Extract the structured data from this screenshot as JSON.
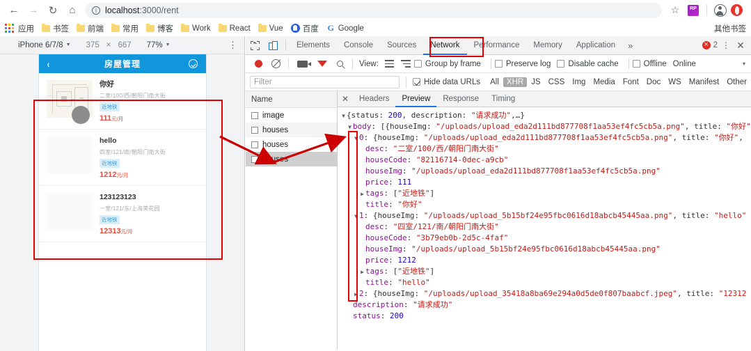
{
  "browser": {
    "url_text": "localhost",
    "url_dim": ":3000/rent",
    "nav": {
      "back": "←",
      "forward": "→",
      "reload": "↻",
      "home": "⌂"
    },
    "star": "☆",
    "bookmarks": [
      {
        "label": "书签",
        "icon": "folder-icon"
      },
      {
        "label": "前端",
        "icon": "folder-icon"
      },
      {
        "label": "常用",
        "icon": "folder-icon"
      },
      {
        "label": "博客",
        "icon": "folder-icon"
      },
      {
        "label": "Work",
        "icon": "folder-icon"
      },
      {
        "label": "React",
        "icon": "folder-icon"
      },
      {
        "label": "Vue",
        "icon": "folder-icon"
      }
    ],
    "apps_label": "应用",
    "baidu_label": "百度",
    "google_label": "Google",
    "other_bookmarks": "其他书签"
  },
  "device_toolbar": {
    "device": "iPhone 6/7/8",
    "width": "375",
    "times": "×",
    "height": "667",
    "zoom": "77%",
    "caret": "▼"
  },
  "app": {
    "header_title": "房屋管理",
    "back_icon": "‹",
    "houses": [
      {
        "title": "你好",
        "desc": "二室/100/西/朝阳门南大街",
        "tag": "近地铁",
        "price": "111",
        "unit": "元/月"
      },
      {
        "title": "hello",
        "desc": "四室/121/南/朝阳门南大街",
        "tag": "近地铁",
        "price": "1212",
        "unit": "元/月"
      },
      {
        "title": "123123123",
        "desc": "一室/121/东/上海荣花园",
        "tag": "近地铁",
        "price": "12313",
        "unit": "元/月"
      }
    ]
  },
  "devtools": {
    "tabs": [
      {
        "label": "Elements",
        "active": false
      },
      {
        "label": "Console",
        "active": false
      },
      {
        "label": "Sources",
        "active": false
      },
      {
        "label": "Network",
        "active": true
      },
      {
        "label": "Performance",
        "active": false
      },
      {
        "label": "Memory",
        "active": false
      },
      {
        "label": "Application",
        "active": false
      }
    ],
    "more_tabs": "»",
    "error_count": "2",
    "close": "✕",
    "controls": {
      "view_label": "View:",
      "group_by_frame": "Group by frame",
      "preserve_log": "Preserve log",
      "disable_cache": "Disable cache",
      "offline": "Offline",
      "online": "Online",
      "caret": "▾"
    },
    "filter": {
      "placeholder": "Filter",
      "value": "",
      "hide_data_urls": "Hide data URLs",
      "types": [
        {
          "label": "All",
          "active": false
        },
        {
          "label": "XHR",
          "active": true
        },
        {
          "label": "JS",
          "active": false
        },
        {
          "label": "CSS",
          "active": false
        },
        {
          "label": "Img",
          "active": false
        },
        {
          "label": "Media",
          "active": false
        },
        {
          "label": "Font",
          "active": false
        },
        {
          "label": "Doc",
          "active": false
        },
        {
          "label": "WS",
          "active": false
        },
        {
          "label": "Manifest",
          "active": false
        },
        {
          "label": "Other",
          "active": false
        }
      ]
    },
    "network": {
      "column_header": "Name",
      "rows": [
        {
          "name": "image",
          "selected": false
        },
        {
          "name": "houses",
          "selected": false
        },
        {
          "name": "houses",
          "selected": false
        },
        {
          "name": "houses",
          "selected": true
        }
      ]
    },
    "detail_tabs": [
      {
        "label": "Headers",
        "active": false
      },
      {
        "label": "Preview",
        "active": true
      },
      {
        "label": "Response",
        "active": false
      },
      {
        "label": "Timing",
        "active": false
      }
    ],
    "preview_json": [
      {
        "indent": 0,
        "tri": "down",
        "parts": [
          {
            "t": "{status: ",
            "c": "p"
          },
          {
            "t": "200",
            "c": "n"
          },
          {
            "t": ", description: ",
            "c": "p"
          },
          {
            "t": "\"请求成功\"",
            "c": "s"
          },
          {
            "t": ",…}",
            "c": "p"
          }
        ]
      },
      {
        "indent": 1,
        "tri": "down",
        "parts": [
          {
            "t": "body",
            "c": "k"
          },
          {
            "t": ": [{houseImg: ",
            "c": "p"
          },
          {
            "t": "\"/uploads/upload_eda2d111bd877708f1aa53ef4fc5cb5a.png\"",
            "c": "s"
          },
          {
            "t": ", title: ",
            "c": "p"
          },
          {
            "t": "\"你好\"",
            "c": "s"
          }
        ]
      },
      {
        "indent": 2,
        "tri": "down",
        "parts": [
          {
            "t": "0",
            "c": "ki"
          },
          {
            "t": ": {houseImg: ",
            "c": "p"
          },
          {
            "t": "\"/uploads/upload_eda2d111bd877708f1aa53ef4fc5cb5a.png\"",
            "c": "s"
          },
          {
            "t": ", title: ",
            "c": "p"
          },
          {
            "t": "\"你好\"",
            "c": "s"
          },
          {
            "t": ",",
            "c": "p"
          }
        ]
      },
      {
        "indent": 3,
        "tri": "blank",
        "parts": [
          {
            "t": "desc",
            "c": "k"
          },
          {
            "t": ": ",
            "c": "p"
          },
          {
            "t": "\"二室/100/西/朝阳门南大街\"",
            "c": "s"
          }
        ]
      },
      {
        "indent": 3,
        "tri": "blank",
        "parts": [
          {
            "t": "houseCode",
            "c": "k"
          },
          {
            "t": ": ",
            "c": "p"
          },
          {
            "t": "\"82116714-0dec-a9cb\"",
            "c": "s"
          }
        ]
      },
      {
        "indent": 3,
        "tri": "blank",
        "parts": [
          {
            "t": "houseImg",
            "c": "k"
          },
          {
            "t": ": ",
            "c": "p"
          },
          {
            "t": "\"/uploads/upload_eda2d111bd877708f1aa53ef4fc5cb5a.png\"",
            "c": "s"
          }
        ]
      },
      {
        "indent": 3,
        "tri": "blank",
        "parts": [
          {
            "t": "price",
            "c": "k"
          },
          {
            "t": ": ",
            "c": "p"
          },
          {
            "t": "111",
            "c": "n"
          }
        ]
      },
      {
        "indent": 3,
        "tri": "right",
        "parts": [
          {
            "t": "tags",
            "c": "k"
          },
          {
            "t": ": [",
            "c": "p"
          },
          {
            "t": "\"近地铁\"",
            "c": "s"
          },
          {
            "t": "]",
            "c": "p"
          }
        ]
      },
      {
        "indent": 3,
        "tri": "blank",
        "parts": [
          {
            "t": "title",
            "c": "k"
          },
          {
            "t": ": ",
            "c": "p"
          },
          {
            "t": "\"你好\"",
            "c": "s"
          }
        ]
      },
      {
        "indent": 2,
        "tri": "down",
        "parts": [
          {
            "t": "1",
            "c": "ki"
          },
          {
            "t": ": {houseImg: ",
            "c": "p"
          },
          {
            "t": "\"/uploads/upload_5b15bf24e95fbc0616d18abcb45445aa.png\"",
            "c": "s"
          },
          {
            "t": ", title: ",
            "c": "p"
          },
          {
            "t": "\"hello\"",
            "c": "s"
          }
        ]
      },
      {
        "indent": 3,
        "tri": "blank",
        "parts": [
          {
            "t": "desc",
            "c": "k"
          },
          {
            "t": ": ",
            "c": "p"
          },
          {
            "t": "\"四室/121/南/朝阳门南大街\"",
            "c": "s"
          }
        ]
      },
      {
        "indent": 3,
        "tri": "blank",
        "parts": [
          {
            "t": "houseCode",
            "c": "k"
          },
          {
            "t": ": ",
            "c": "p"
          },
          {
            "t": "\"3b79eb0b-2d5c-4faf\"",
            "c": "s"
          }
        ]
      },
      {
        "indent": 3,
        "tri": "blank",
        "parts": [
          {
            "t": "houseImg",
            "c": "k"
          },
          {
            "t": ": ",
            "c": "p"
          },
          {
            "t": "\"/uploads/upload_5b15bf24e95fbc0616d18abcb45445aa.png\"",
            "c": "s"
          }
        ]
      },
      {
        "indent": 3,
        "tri": "blank",
        "parts": [
          {
            "t": "price",
            "c": "k"
          },
          {
            "t": ": ",
            "c": "p"
          },
          {
            "t": "1212",
            "c": "n"
          }
        ]
      },
      {
        "indent": 3,
        "tri": "right",
        "parts": [
          {
            "t": "tags",
            "c": "k"
          },
          {
            "t": ": [",
            "c": "p"
          },
          {
            "t": "\"近地铁\"",
            "c": "s"
          },
          {
            "t": "]",
            "c": "p"
          }
        ]
      },
      {
        "indent": 3,
        "tri": "blank",
        "parts": [
          {
            "t": "title",
            "c": "k"
          },
          {
            "t": ": ",
            "c": "p"
          },
          {
            "t": "\"hello\"",
            "c": "s"
          }
        ]
      },
      {
        "indent": 2,
        "tri": "right",
        "parts": [
          {
            "t": "2",
            "c": "ki"
          },
          {
            "t": ": {houseImg: ",
            "c": "p"
          },
          {
            "t": "\"/uploads/upload_35418a8ba69e294a0d5de0f807baabcf.jpeg\"",
            "c": "s"
          },
          {
            "t": ", title: ",
            "c": "p"
          },
          {
            "t": "\"12312",
            "c": "s"
          }
        ]
      },
      {
        "indent": 1,
        "tri": "blank",
        "parts": [
          {
            "t": "description",
            "c": "k"
          },
          {
            "t": ": ",
            "c": "p"
          },
          {
            "t": "\"请求成功\"",
            "c": "s"
          }
        ]
      },
      {
        "indent": 1,
        "tri": "blank",
        "parts": [
          {
            "t": "status",
            "c": "k"
          },
          {
            "t": ": ",
            "c": "p"
          },
          {
            "t": "200",
            "c": "n"
          }
        ]
      }
    ]
  },
  "annotations": {
    "accent_color": "#e60000",
    "boxes": [
      {
        "name": "network-tab-highlight"
      },
      {
        "name": "app-list-highlight"
      },
      {
        "name": "json-index-highlight"
      }
    ]
  }
}
